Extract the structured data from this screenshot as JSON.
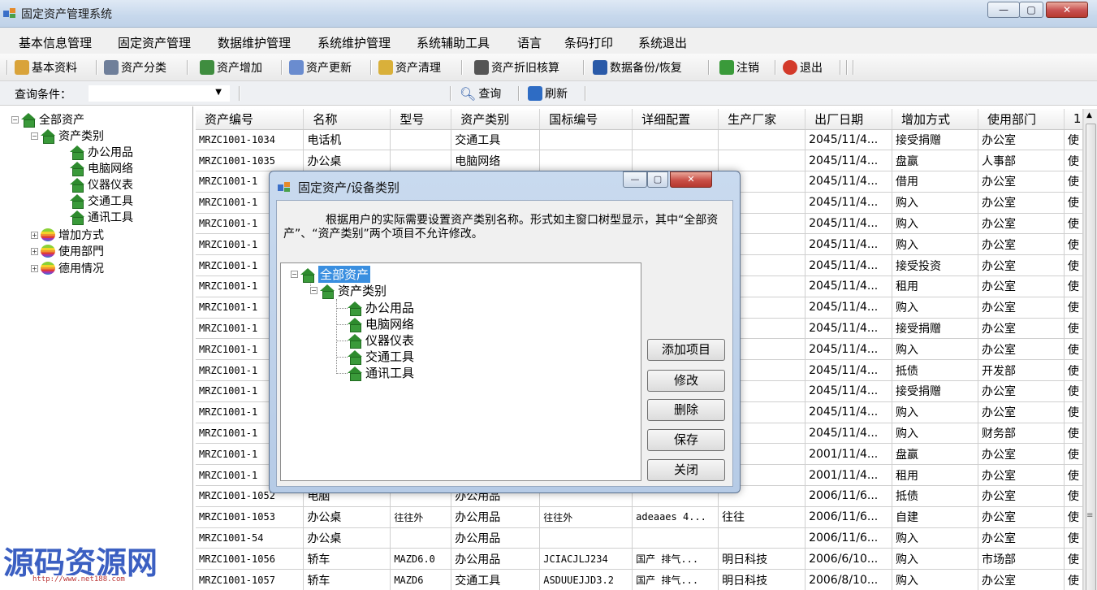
{
  "window": {
    "title": "固定资产管理系统"
  },
  "menu": [
    "基本信息管理",
    "固定资产管理",
    "数据维护管理",
    "系统维护管理",
    "系统辅助工具",
    "语言",
    "条码打印",
    "系统退出"
  ],
  "toolbar": [
    {
      "label": "基本资料",
      "icon": "people-icon",
      "color": "#d9a33a"
    },
    {
      "label": "资产分类",
      "icon": "gear-icon",
      "color": "#6f7f9a"
    },
    {
      "label": "资产增加",
      "icon": "hardware-icon",
      "color": "#3f8d3f"
    },
    {
      "label": "资产更新",
      "icon": "cog-icon",
      "color": "#6a8ccf"
    },
    {
      "label": "资产清理",
      "icon": "magic-icon",
      "color": "#d9b03a"
    },
    {
      "label": "资产折旧核算",
      "icon": "pen-icon",
      "color": "#555555"
    },
    {
      "label": "数据备份/恢复",
      "icon": "disk-icon",
      "color": "#2a5aa8"
    },
    {
      "label": "注销",
      "icon": "running-man-icon",
      "color": "#3a9a3a"
    },
    {
      "label": "退出",
      "icon": "close-circle-icon",
      "color": "#d33a2a"
    }
  ],
  "query": {
    "label": "查询条件：",
    "value": "",
    "search": "查询",
    "refresh": "刷新"
  },
  "tree": {
    "root": "全部资产",
    "category": "资产类别",
    "children": [
      "办公用品",
      "电脑网络",
      "仪器仪表",
      "交通工具",
      "通讯工具"
    ],
    "others": [
      "增加方式",
      "使用部門",
      "德用情况"
    ]
  },
  "grid": {
    "columns": [
      "资产编号",
      "名称",
      "型号",
      "资产类别",
      "国标编号",
      "详细配置",
      "生产厂家",
      "出厂日期",
      "增加方式",
      "使用部门",
      "1"
    ],
    "rows": [
      [
        "MRZC1001-1034",
        "电话机",
        "",
        "交通工具",
        "",
        "",
        "",
        "2045/11/4...",
        "接受捐赠",
        "办公室",
        "使"
      ],
      [
        "MRZC1001-1035",
        "办公桌",
        "",
        "电脑网络",
        "",
        "",
        "",
        "2045/11/4...",
        "盘赢",
        "人事部",
        "使"
      ],
      [
        "MRZC1001-1",
        "",
        "",
        "",
        "",
        "",
        "",
        "2045/11/4...",
        "借用",
        "办公室",
        "使"
      ],
      [
        "MRZC1001-1",
        "",
        "",
        "",
        "",
        "",
        "",
        "2045/11/4...",
        "购入",
        "办公室",
        "使"
      ],
      [
        "MRZC1001-1",
        "",
        "",
        "",
        "",
        "",
        "",
        "2045/11/4...",
        "购入",
        "办公室",
        "使"
      ],
      [
        "MRZC1001-1",
        "",
        "",
        "",
        "",
        "",
        "",
        "2045/11/4...",
        "购入",
        "办公室",
        "使"
      ],
      [
        "MRZC1001-1",
        "",
        "",
        "",
        "",
        "",
        "",
        "2045/11/4...",
        "接受投资",
        "办公室",
        "使"
      ],
      [
        "MRZC1001-1",
        "",
        "",
        "",
        "",
        "",
        "",
        "2045/11/4...",
        "租用",
        "办公室",
        "使"
      ],
      [
        "MRZC1001-1",
        "",
        "",
        "",
        "",
        "",
        "",
        "2045/11/4...",
        "购入",
        "办公室",
        "使"
      ],
      [
        "MRZC1001-1",
        "",
        "",
        "",
        "",
        "",
        "",
        "2045/11/4...",
        "接受捐赠",
        "办公室",
        "使"
      ],
      [
        "MRZC1001-1",
        "",
        "",
        "",
        "",
        "",
        "",
        "2045/11/4...",
        "购入",
        "办公室",
        "使"
      ],
      [
        "MRZC1001-1",
        "",
        "",
        "",
        "",
        "",
        "",
        "2045/11/4...",
        "抵债",
        "开发部",
        "使"
      ],
      [
        "MRZC1001-1",
        "",
        "",
        "",
        "",
        "",
        "",
        "2045/11/4...",
        "接受捐赠",
        "办公室",
        "使"
      ],
      [
        "MRZC1001-1",
        "",
        "",
        "",
        "",
        "",
        "",
        "2045/11/4...",
        "购入",
        "办公室",
        "使"
      ],
      [
        "MRZC1001-1",
        "",
        "",
        "",
        "",
        "",
        "",
        "2045/11/4...",
        "购入",
        "财务部",
        "使"
      ],
      [
        "MRZC1001-1",
        "",
        "",
        "",
        "",
        "",
        "",
        "2001/11/4...",
        "盘赢",
        "办公室",
        "使"
      ],
      [
        "MRZC1001-1",
        "",
        "",
        "",
        "",
        "",
        "",
        "2001/11/4...",
        "租用",
        "办公室",
        "使"
      ],
      [
        "MRZC1001-1052",
        "电脑",
        "",
        "办公用品",
        "",
        "",
        "",
        "2006/11/6...",
        "抵债",
        "办公室",
        "使"
      ],
      [
        "MRZC1001-1053",
        "办公桌",
        "往往外",
        "办公用品",
        "往往外",
        "adeaaes 4...",
        "往往",
        "2006/11/6...",
        "自建",
        "办公室",
        "使"
      ],
      [
        "MRZC1001-54",
        "办公桌",
        "",
        "办公用品",
        "",
        "",
        "",
        "2006/11/6...",
        "购入",
        "办公室",
        "使"
      ],
      [
        "MRZC1001-1056",
        "轿车",
        "MAZD6.0",
        "办公用品",
        "JCIACJLJ234",
        "国产 排气...",
        "明日科技",
        "2006/6/10...",
        "购入",
        "市场部",
        "使"
      ],
      [
        "MRZC1001-1057",
        "轿车",
        "MAZD6",
        "交通工具",
        "ASDUUEJJD3.2",
        "国产 排气...",
        "明日科技",
        "2006/8/10...",
        "购入",
        "办公室",
        "使"
      ]
    ]
  },
  "dialog": {
    "title": "固定资产/设备类别",
    "description": "根据用户的实际需要设置资产类别名称。形式如主窗口树型显示，其中“全部资产”、“资产类别”两个项目不允许修改。",
    "tree_root": "全部资产",
    "tree_category": "资产类别",
    "tree_children": [
      "办公用品",
      "电脑网络",
      "仪器仪表",
      "交通工具",
      "通讯工具"
    ],
    "buttons": [
      "添加项目",
      "修改",
      "删除",
      "保存",
      "关闭"
    ]
  },
  "watermark": {
    "text": "源码资源网",
    "url": "http://www.net188.com"
  }
}
